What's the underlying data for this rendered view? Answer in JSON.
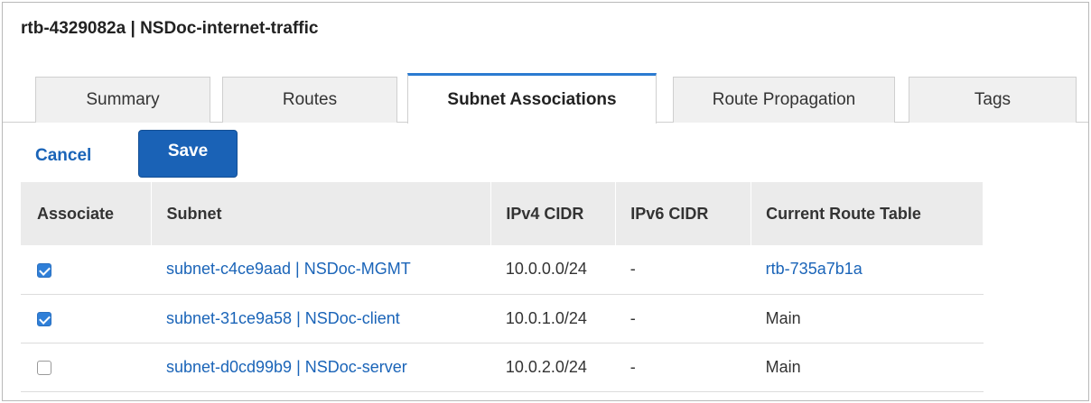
{
  "title": "rtb-4329082a | NSDoc-internet-traffic",
  "tabs": [
    {
      "label": "Summary",
      "active": false
    },
    {
      "label": "Routes",
      "active": false
    },
    {
      "label": "Subnet Associations",
      "active": true
    },
    {
      "label": "Route Propagation",
      "active": false
    },
    {
      "label": "Tags",
      "active": false
    }
  ],
  "actions": {
    "cancel_label": "Cancel",
    "save_label": "Save"
  },
  "table": {
    "headers": [
      "Associate",
      "Subnet",
      "IPv4 CIDR",
      "IPv6 CIDR",
      "Current Route Table"
    ],
    "rows": [
      {
        "checked": true,
        "subnet": "subnet-c4ce9aad | NSDoc-MGMT",
        "ipv4": "10.0.0.0/24",
        "ipv6": "-",
        "route_table": "rtb-735a7b1a",
        "route_table_is_link": true
      },
      {
        "checked": true,
        "subnet": "subnet-31ce9a58 | NSDoc-client",
        "ipv4": "10.0.1.0/24",
        "ipv6": "-",
        "route_table": "Main",
        "route_table_is_link": false
      },
      {
        "checked": false,
        "subnet": "subnet-d0cd99b9 | NSDoc-server",
        "ipv4": "10.0.2.0/24",
        "ipv6": "-",
        "route_table": "Main",
        "route_table_is_link": false
      }
    ]
  },
  "colors": {
    "accent": "#2b7bd1",
    "link": "#1a64b8",
    "save_button": "#1a62b6",
    "header_bg": "#ebebeb",
    "tab_bg": "#f0f0f0"
  }
}
